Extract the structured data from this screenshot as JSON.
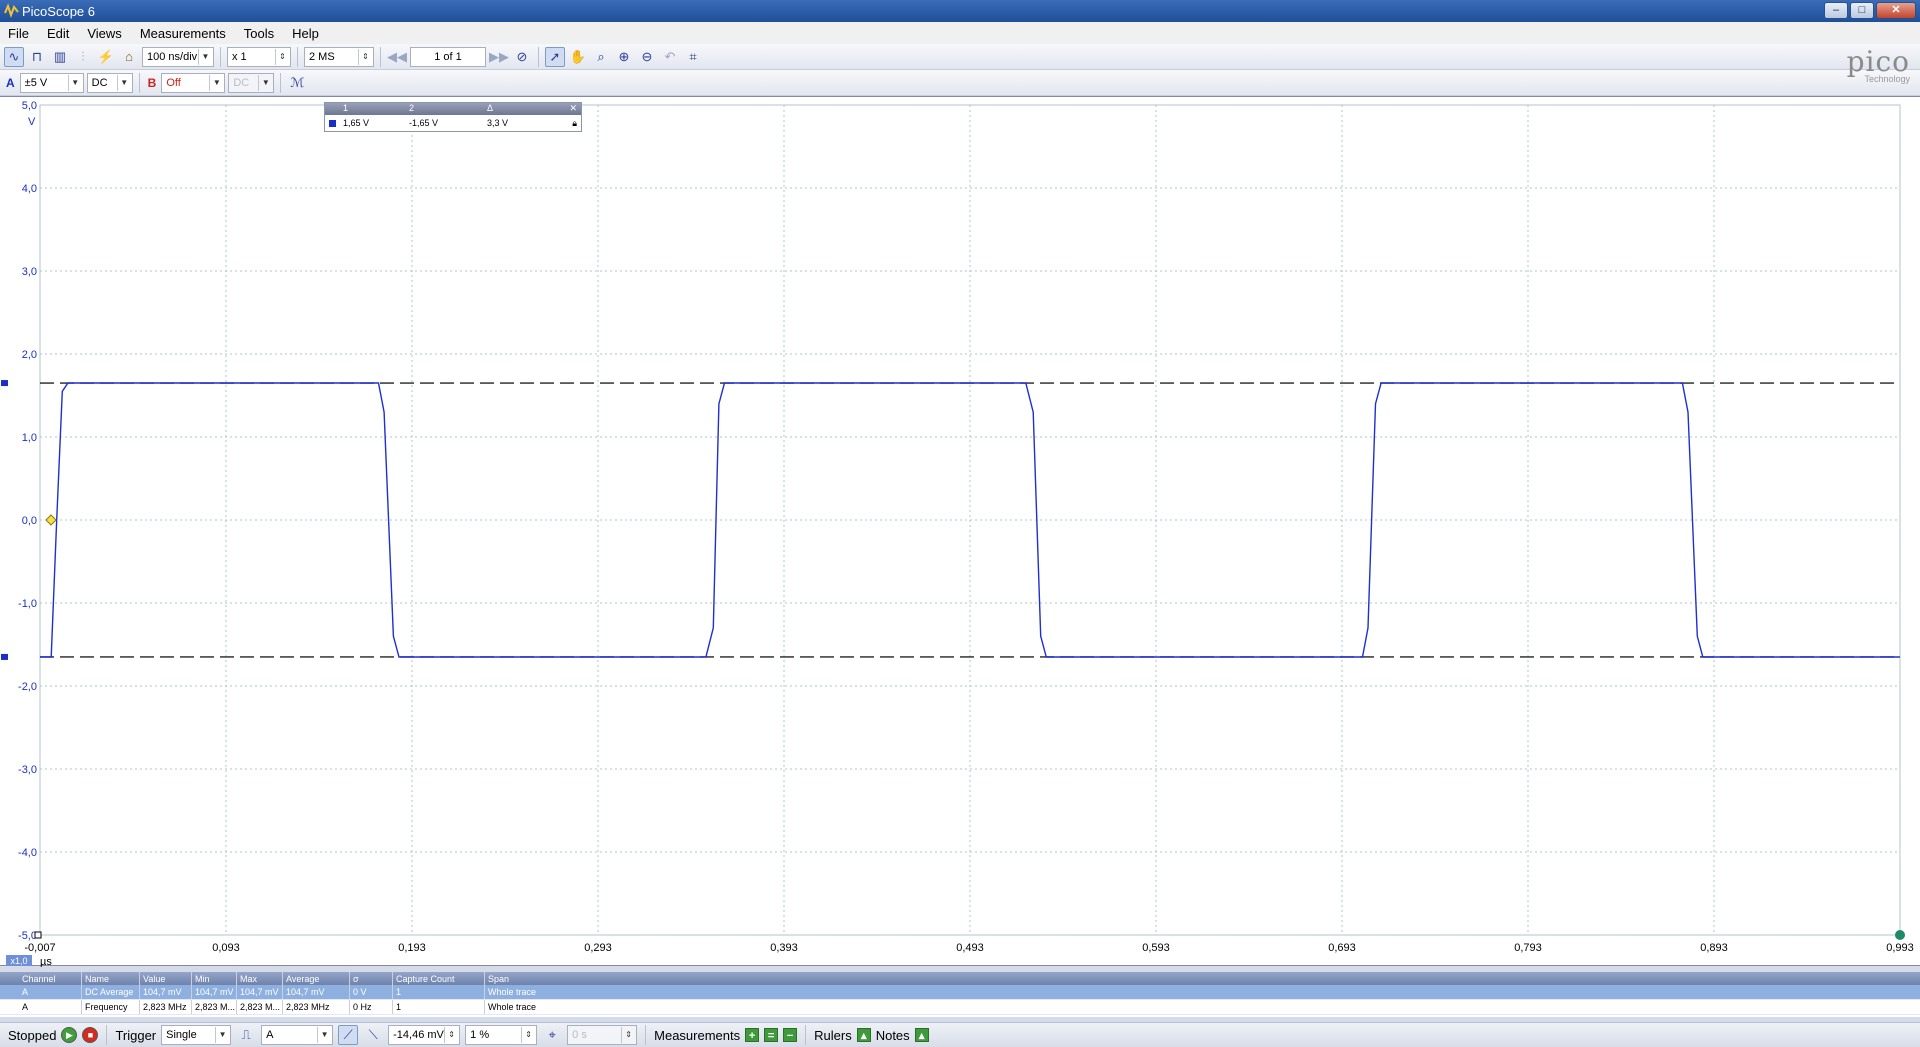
{
  "window": {
    "title": "PicoScope 6",
    "minimize": "–",
    "maximize": "□",
    "close": "✕"
  },
  "menu": [
    "File",
    "Edit",
    "Views",
    "Measurements",
    "Tools",
    "Help"
  ],
  "toolbar": {
    "timebase": "100 ns/div",
    "zoom": "x 1",
    "samples": "2 MS",
    "capture_nav": "1 of 1"
  },
  "channels": {
    "a_label": "A",
    "a_range": "±5 V",
    "a_coupling": "DC",
    "b_label": "B",
    "b_range": "Off",
    "b_coupling": "DC"
  },
  "logo": {
    "word": "pico",
    "sub": "Technology"
  },
  "ruler_legend": {
    "headers": [
      "1",
      "2",
      "Δ"
    ],
    "values": [
      "1,65 V",
      "-1,65 V",
      "3,3 V"
    ]
  },
  "chart_data": {
    "type": "line",
    "y_unit": "V",
    "x_unit": "µs",
    "zoom_badge": "x1,0",
    "ylim": [
      -5,
      5
    ],
    "xlim": [
      -0.007,
      0.993
    ],
    "y_ticks": [
      "5,0",
      "4,0",
      "3,0",
      "2,0",
      "1,0",
      "0,0",
      "-1,0",
      "-2,0",
      "-3,0",
      "-4,0",
      "-5,0"
    ],
    "x_ticks": [
      "-0,007",
      "0,093",
      "0,193",
      "0,293",
      "0,393",
      "0,493",
      "0,593",
      "0,693",
      "0,793",
      "0,893",
      "0,993"
    ],
    "grid": true,
    "ruler_levels": [
      1.65,
      -1.65
    ],
    "trigger_level": 0.0,
    "series": [
      {
        "color": "#1f2fd0",
        "x": [
          -0.007,
          -0.001,
          0.002,
          0.005,
          0.008,
          0.175,
          0.178,
          0.183,
          0.186,
          0.351,
          0.355,
          0.358,
          0.361,
          0.523,
          0.527,
          0.531,
          0.534,
          0.704,
          0.707,
          0.711,
          0.714,
          0.876,
          0.879,
          0.884,
          0.887,
          0.993
        ],
        "values": [
          -1.65,
          -1.65,
          0.0,
          1.55,
          1.65,
          1.65,
          1.3,
          -1.4,
          -1.65,
          -1.65,
          -1.3,
          1.4,
          1.65,
          1.65,
          1.3,
          -1.4,
          -1.65,
          -1.65,
          -1.3,
          1.4,
          1.65,
          1.65,
          1.3,
          -1.4,
          -1.65,
          -1.65
        ]
      }
    ]
  },
  "measurements": {
    "headers": [
      "Channel",
      "Name",
      "Value",
      "Min",
      "Max",
      "Average",
      "σ",
      "Capture Count",
      "Span"
    ],
    "rows": [
      [
        "A",
        "DC Average",
        "104,7 mV",
        "104,7 mV",
        "104,7 mV",
        "104,7 mV",
        "0 V",
        "1",
        "Whole trace"
      ],
      [
        "A",
        "Frequency",
        "2,823 MHz",
        "2,823 M...",
        "2,823 M...",
        "2,823 MHz",
        "0 Hz",
        "1",
        "Whole trace"
      ]
    ]
  },
  "status": {
    "state": "Stopped",
    "trigger_label": "Trigger",
    "trigger_mode": "Single",
    "trigger_source": "A",
    "trigger_level": "-14,46 mV",
    "hysteresis": "1 %",
    "pre_trigger": "0 s",
    "measurements_label": "Measurements",
    "rulers_label": "Rulers",
    "notes_label": "Notes"
  }
}
